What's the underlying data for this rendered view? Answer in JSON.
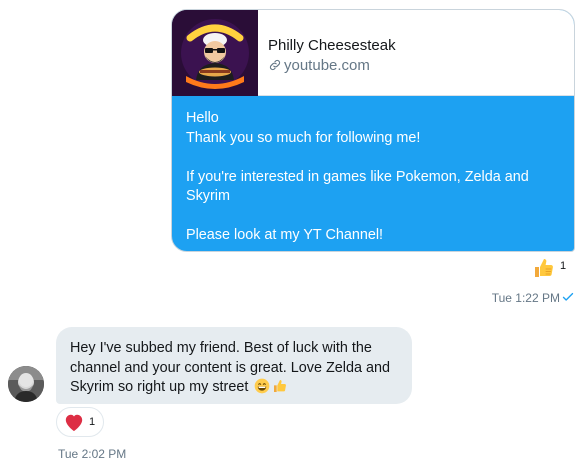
{
  "conversation": {
    "outgoing": {
      "link_card": {
        "thumbnail_text": "PHILLY CHEESESTEAK",
        "title": "Philly Cheesesteak",
        "domain": "youtube.com"
      },
      "lines": [
        "Hello",
        "Thank you so much for following me!",
        "",
        "If you're interested in games like Pokemon, Zelda and Skyrim",
        "",
        "Please look at my YT Channel!"
      ],
      "reaction": {
        "icon": "thumbs-up-icon",
        "count": "1"
      },
      "timestamp": "Tue 1:22 PM",
      "status_icon": "check-icon"
    },
    "incoming": {
      "text": "Hey I've subbed my friend. Best of luck with the channel and your content is great. Love Zelda and Skyrim so right up my street",
      "emojis": [
        "grinning-face-icon",
        "thumbs-up-icon"
      ],
      "reaction": {
        "icon": "heart-icon",
        "count": "1"
      },
      "timestamp": "Tue 2:02 PM"
    }
  },
  "colors": {
    "sent_bubble": "#1da1f2",
    "received_bubble": "#e6ecf0",
    "muted_text": "#657786",
    "heart": "#e0245e",
    "check": "#1da1f2"
  }
}
